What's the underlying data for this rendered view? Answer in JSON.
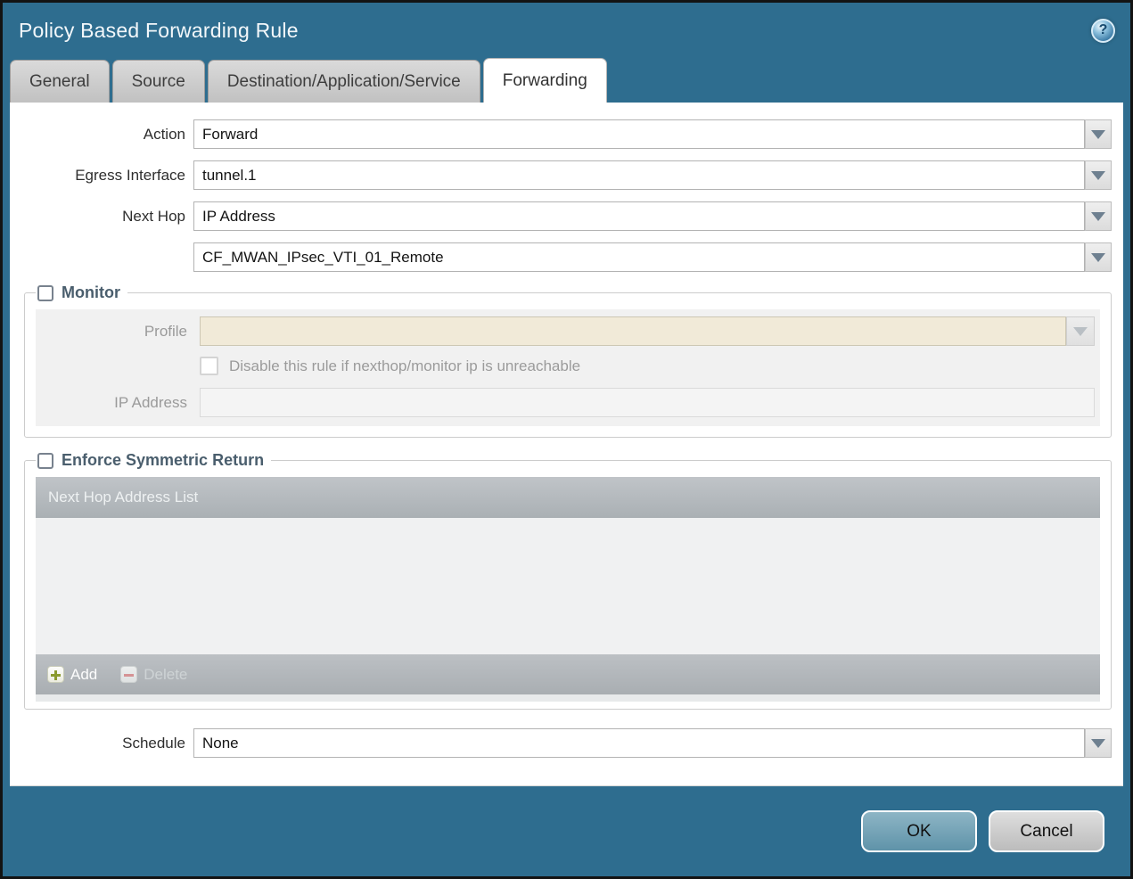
{
  "window": {
    "title": "Policy Based Forwarding Rule",
    "help_glyph": "?"
  },
  "tabs": [
    {
      "label": "General",
      "active": false
    },
    {
      "label": "Source",
      "active": false
    },
    {
      "label": "Destination/Application/Service",
      "active": false
    },
    {
      "label": "Forwarding",
      "active": true
    }
  ],
  "form": {
    "action": {
      "label": "Action",
      "value": "Forward"
    },
    "egress_interface": {
      "label": "Egress Interface",
      "value": "tunnel.1"
    },
    "next_hop": {
      "label": "Next Hop",
      "value": "IP Address"
    },
    "next_hop_address": {
      "value": "CF_MWAN_IPsec_VTI_01_Remote"
    },
    "schedule": {
      "label": "Schedule",
      "value": "None"
    }
  },
  "monitor": {
    "title": "Monitor",
    "checked": false,
    "profile": {
      "label": "Profile",
      "value": ""
    },
    "disable_rule_label": "Disable this rule if nexthop/monitor ip is unreachable",
    "disable_rule_checked": false,
    "ip_address": {
      "label": "IP Address",
      "value": ""
    }
  },
  "enforce": {
    "title": "Enforce Symmetric Return",
    "checked": false,
    "table_header": "Next Hop Address List",
    "rows": [],
    "add_label": "Add",
    "delete_label": "Delete"
  },
  "footer": {
    "ok": "OK",
    "cancel": "Cancel"
  },
  "colors": {
    "frame_teal": "#2e6d8f",
    "inactive_tab_bg": "#c6c6c6",
    "active_tab_bg": "#ffffff",
    "section_title": "#4a5e6d",
    "table_bar_gray": "#b3b8bb",
    "disabled_profile_field_bg": "#f1ead8",
    "ok_button_bg": "#6ba2b8",
    "cancel_button_bg": "#c9c9c9",
    "add_icon_green": "#8a9a2e",
    "delete_icon_red": "#d59395"
  }
}
